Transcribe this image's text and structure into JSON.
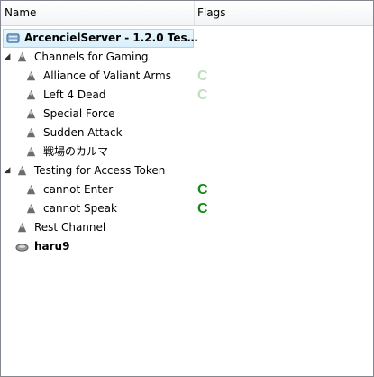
{
  "columns": {
    "name": "Name",
    "flags": "Flags"
  },
  "server": {
    "label": "ArcencielServer - 1.2.0 Tes…"
  },
  "groups": [
    {
      "label": "Channels for Gaming",
      "channels": [
        {
          "label": "Alliance of Valiant Arms",
          "flag": "C",
          "flag_state": "inactive"
        },
        {
          "label": "Left 4 Dead",
          "flag": "C",
          "flag_state": "inactive"
        },
        {
          "label": "Special Force",
          "flag": "",
          "flag_state": "none"
        },
        {
          "label": "Sudden Attack",
          "flag": "",
          "flag_state": "none"
        },
        {
          "label": "戦場のカルマ",
          "flag": "",
          "flag_state": "none"
        }
      ]
    },
    {
      "label": "Testing for Access Token",
      "channels": [
        {
          "label": "cannot Enter",
          "flag": "C",
          "flag_state": "active"
        },
        {
          "label": "cannot Speak",
          "flag": "C",
          "flag_state": "active"
        }
      ]
    }
  ],
  "rest_channel": {
    "label": "Rest Channel"
  },
  "user": {
    "label": "haru9"
  },
  "icons": {
    "server": "server-icon",
    "channel": "channel-icon",
    "user": "user-icon",
    "expand": "expand-arrow-icon"
  },
  "colors": {
    "flag_active": "#138a13",
    "flag_inactive": "#bfe0bf",
    "selection": "#d9f0fc"
  }
}
